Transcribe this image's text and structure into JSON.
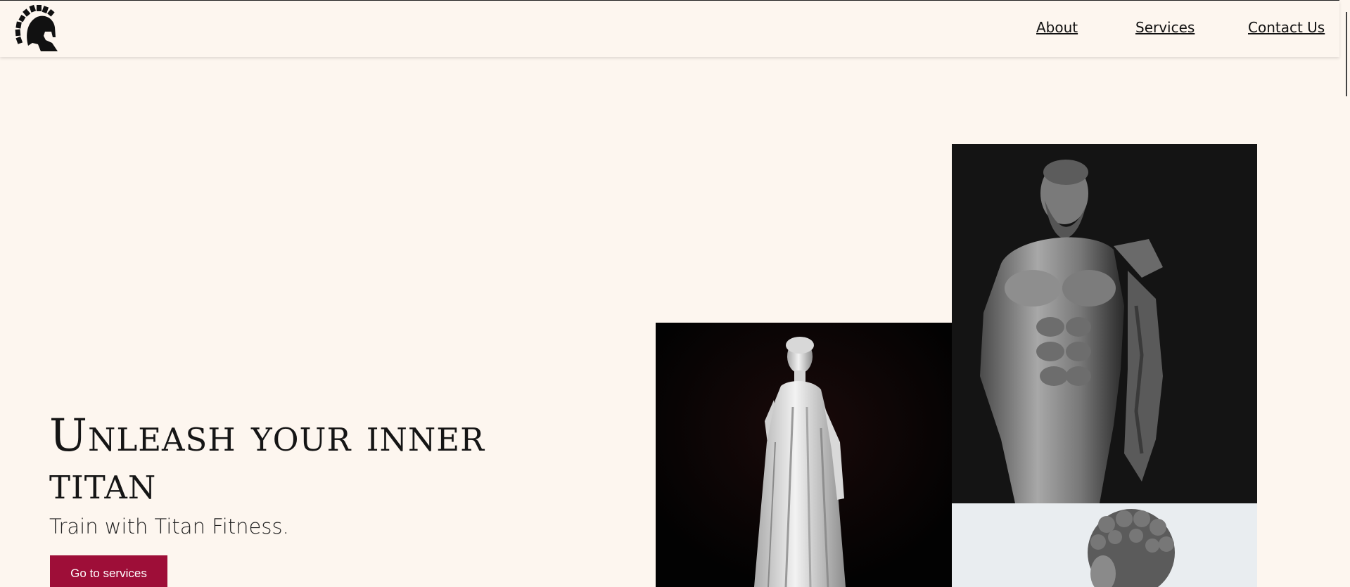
{
  "header": {
    "logo_icon": "spartan-helmet-icon",
    "nav": {
      "about": "About",
      "services": "Services",
      "contact": "Contact Us"
    }
  },
  "hero": {
    "title": "Unleash your inner titan",
    "subtitle": "Train with Titan Fitness.",
    "cta_label": "Go to services"
  },
  "gallery": {
    "images": [
      {
        "subject": "white marble statue of a draped woman on black background"
      },
      {
        "subject": "marble Hercules torso statue on dark background"
      },
      {
        "subject": "curly-haired marble bust on light background"
      }
    ]
  },
  "colors": {
    "background": "#fdf6ef",
    "accent": "#9e0e38",
    "text": "#151515"
  }
}
